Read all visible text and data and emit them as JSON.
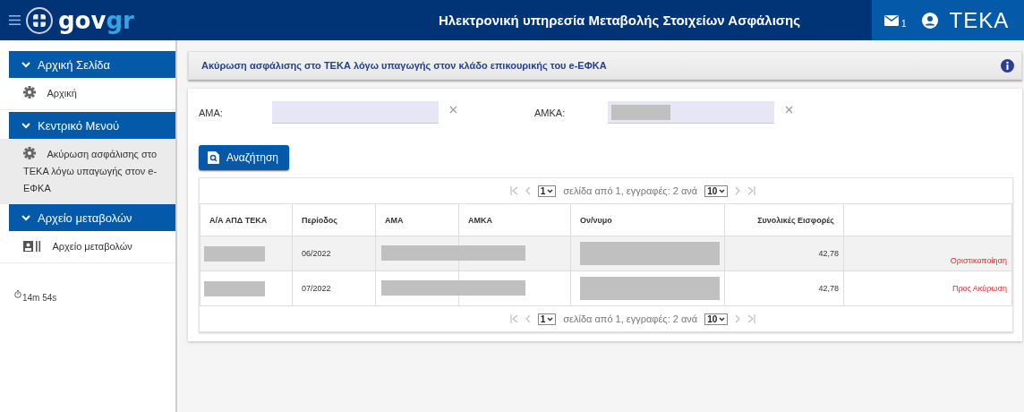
{
  "header": {
    "logo_left": "gov",
    "logo_right": "gr",
    "title": "Ηλεκτρονική υπηρεσία Μεταβολής Στοιχείων Ασφάλισης",
    "mail_count": "1",
    "brand": "TEKA"
  },
  "sidebar": {
    "sections": [
      {
        "title": "Αρχική Σελίδα",
        "expanded": true,
        "items": [
          {
            "label": "Αρχική",
            "kind": "gear",
            "selected": false
          }
        ]
      },
      {
        "title": "Κεντρικό Μενού",
        "expanded": true,
        "items": [
          {
            "label": "Ακύρωση ασφάλισης στο ΤΕΚΑ λόγω υπαγωγής στον e-ΕΦΚΑ",
            "kind": "gear",
            "selected": true
          }
        ]
      },
      {
        "title": "Αρχείο μεταβολών",
        "expanded": true,
        "items": [
          {
            "label": "Αρχείο μεταβολών",
            "kind": "card",
            "selected": false
          }
        ]
      }
    ],
    "timer": "14m 54s"
  },
  "page_title": "Ακύρωση ασφάλισης στο ΤΕΚΑ λόγω υπαγωγής στον κλάδο επικουρικής του e-ΕΦΚΑ",
  "form": {
    "fields": [
      {
        "label": "ΑΜΑ:",
        "redacted": false
      },
      {
        "label": "ΑΜΚΑ:",
        "redacted": true
      }
    ],
    "search_button": "Αναζήτηση"
  },
  "table": {
    "pagers": [
      {
        "page": "1",
        "text": "σελίδα από 1, εγγραφές: 2 ανά",
        "page_size": "10"
      },
      {
        "page": "1",
        "text": "σελίδα από 1, εγγραφές: 2 ανά",
        "page_size": "10"
      }
    ],
    "columns": [
      "Α/Α ΑΠΔ ΤΕΚΑ",
      "Περίοδος",
      "ΑΜΑ",
      "ΑΜΚΑ",
      "Ον/νυμο",
      "Συνολικές Εισφορές"
    ],
    "rows": [
      {
        "highlighted": true,
        "cells": [
          {
            "kind": "redacted"
          },
          {
            "kind": "text",
            "text": "06/2022"
          },
          {
            "kind": "redacted_wide"
          },
          {
            "kind": "empty"
          },
          {
            "kind": "redacted"
          },
          {
            "kind": "number",
            "text": "42,78"
          },
          {
            "kind": "status",
            "text": "Οριστικοποίηση"
          }
        ]
      },
      {
        "highlighted": false,
        "cells": [
          {
            "kind": "redacted"
          },
          {
            "kind": "text",
            "text": "07/2022"
          },
          {
            "kind": "redacted_wide"
          },
          {
            "kind": "empty"
          },
          {
            "kind": "redacted"
          },
          {
            "kind": "number",
            "text": "42,78"
          },
          {
            "kind": "status",
            "text": "Προς Ακύρωση"
          }
        ]
      }
    ]
  }
}
